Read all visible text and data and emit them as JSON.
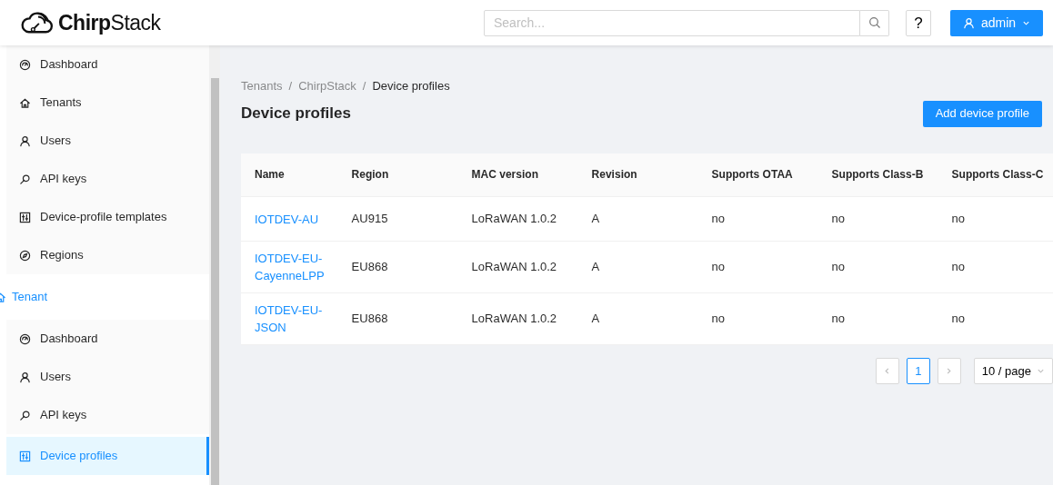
{
  "header": {
    "logo": "ChirpStack",
    "search": {
      "placeholder": "Search..."
    },
    "help": "?",
    "user": "admin"
  },
  "sidebar": {
    "items": [
      {
        "label": "Dashboard",
        "selected": false
      },
      {
        "label": "Tenants",
        "selected": false
      },
      {
        "label": "Users",
        "selected": false
      },
      {
        "label": "API keys",
        "selected": false
      },
      {
        "label": "Device-profile templates",
        "selected": false
      },
      {
        "label": "Regions",
        "selected": false
      }
    ],
    "group": {
      "label": "Tenant",
      "children": [
        {
          "label": "Dashboard",
          "selected": false
        },
        {
          "label": "Users",
          "selected": false
        },
        {
          "label": "API keys",
          "selected": false
        },
        {
          "label": "Device profiles",
          "selected": true
        }
      ]
    }
  },
  "breadcrumb": {
    "items": [
      "Tenants",
      "ChirpStack",
      "Device profiles"
    ],
    "separator": "/"
  },
  "page_title": "Device profiles",
  "add_button": "Add device profile",
  "table": {
    "columns": [
      "Name",
      "Region",
      "MAC version",
      "Revision",
      "Supports OTAA",
      "Supports Class-B",
      "Supports Class-C"
    ],
    "rows": [
      [
        "IOTDEV-AU",
        "AU915",
        "LoRaWAN 1.0.2",
        "A",
        "no",
        "no",
        "no"
      ],
      [
        "IOTDEV-EU-CayenneLPP",
        "EU868",
        "LoRaWAN 1.0.2",
        "A",
        "no",
        "no",
        "no"
      ],
      [
        "IOTDEV-EU-JSON",
        "EU868",
        "LoRaWAN 1.0.2",
        "A",
        "no",
        "no",
        "no"
      ]
    ]
  },
  "pagination": {
    "pages": [
      {
        "label": "1",
        "selected": true
      }
    ],
    "page_size": "10 / page"
  }
}
